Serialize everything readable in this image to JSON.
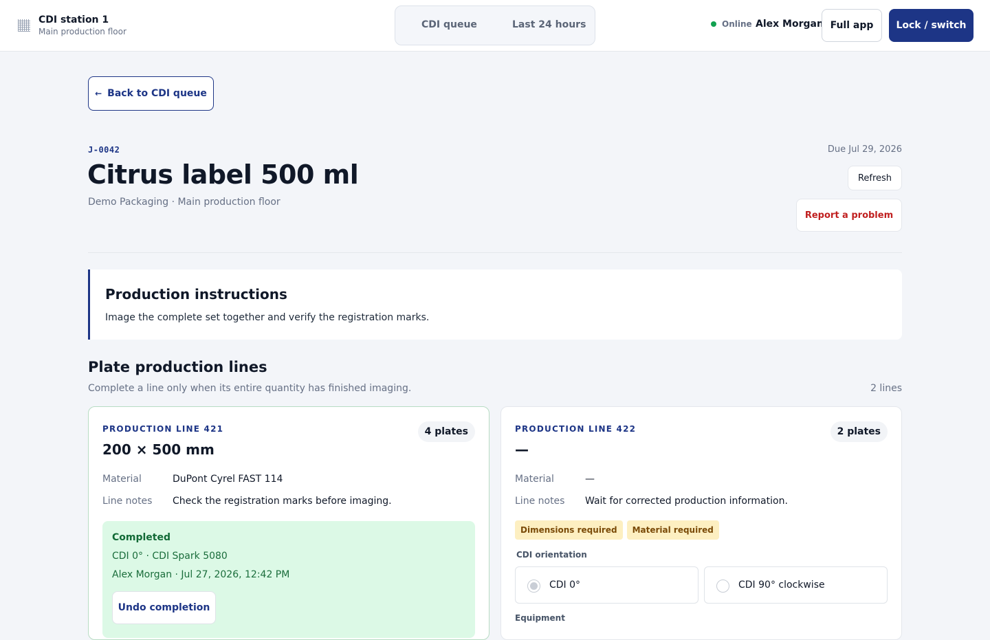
{
  "header": {
    "station_title": "CDI station 1",
    "station_sub": "Main production floor",
    "segment": [
      "CDI queue",
      "Last 24 hours"
    ],
    "status": "Online",
    "user": "Alex Morgan",
    "full_app": "Full app",
    "lock": "Lock / switch"
  },
  "nav": {
    "back": "Back to CDI queue"
  },
  "job": {
    "id": "J-0042",
    "title": "Citrus label 500 ml",
    "subtitle": "Demo Packaging · Main production floor",
    "due": "Due Jul 29, 2026",
    "refresh": "Refresh",
    "report": "Report a problem"
  },
  "instructions": {
    "title": "Production instructions",
    "body": "Image the complete set together and verify the registration marks."
  },
  "lines_section": {
    "title": "Plate production lines",
    "subtitle": "Complete a line only when its entire quantity has finished imaging.",
    "count": "2 lines"
  },
  "lines": [
    {
      "label": "PRODUCTION LINE 421",
      "plates": "4 plates",
      "dims": "200 × 500 mm",
      "material_label": "Material",
      "material": "DuPont Cyrel FAST 114",
      "notes_label": "Line notes",
      "notes": "Check the registration marks before imaging.",
      "completed": {
        "title": "Completed",
        "line1": "CDI 0° · CDI Spark 5080",
        "line2": "Alex Morgan · Jul 27, 2026, 12:42 PM",
        "undo": "Undo completion"
      }
    },
    {
      "label": "PRODUCTION LINE 422",
      "plates": "2 plates",
      "dims": "—",
      "material_label": "Material",
      "material": "—",
      "notes_label": "Line notes",
      "notes": "Wait for corrected production information.",
      "tags": [
        "Dimensions required",
        "Material required"
      ],
      "orientation_label": "CDI orientation",
      "orientation_options": [
        "CDI 0°",
        "CDI 90° clockwise"
      ],
      "equipment_label": "Equipment"
    }
  ],
  "colors": {
    "accent": "#1d3586",
    "online": "#12a150",
    "danger": "#c01f1f",
    "success_bg": "#dcf9e6",
    "warn_bg": "#fdefc1"
  }
}
